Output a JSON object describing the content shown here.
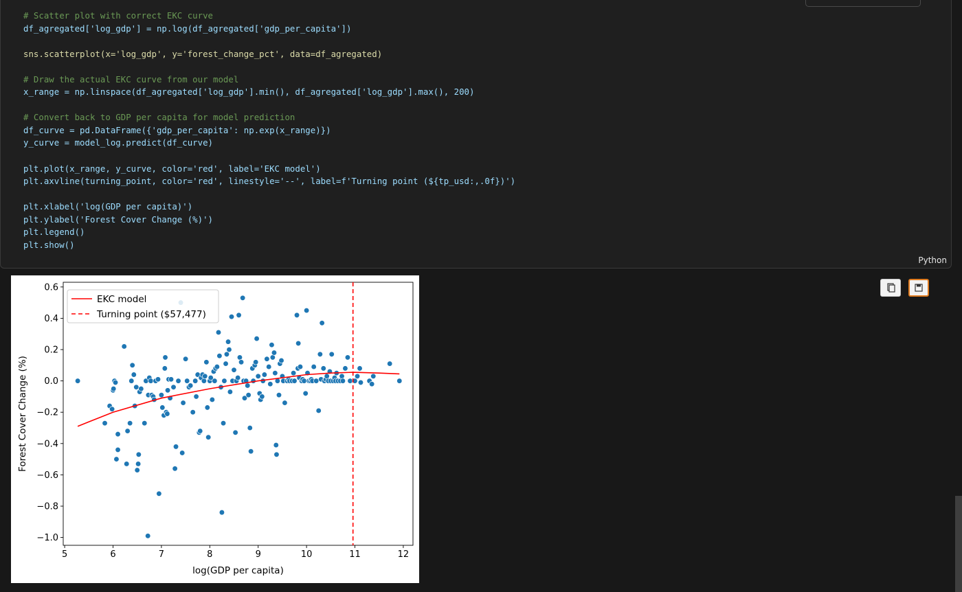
{
  "code_cell": {
    "language": "Python",
    "lines": [
      "# Scatter plot with correct EKC curve",
      "df_agregated['log_gdp'] = np.log(df_agregated['gdp_per_capita'])",
      "",
      "sns.scatterplot(x='log_gdp', y='forest_change_pct', data=df_agregated)",
      "",
      "# Draw the actual EKC curve from our model",
      "x_range = np.linspace(df_agregated['log_gdp'].min(), df_agregated['log_gdp'].max(), 200)",
      "",
      "# Convert back to GDP per capita for model prediction",
      "df_curve = pd.DataFrame({'gdp_per_capita': np.exp(x_range)})",
      "y_curve = model_log.predict(df_curve)",
      "",
      "plt.plot(x_range, y_curve, color='red', label='EKC model')",
      "plt.axvline(turning_point, color='red', linestyle='--', label=f'Turning point (${tp_usd:,.0f})')",
      "",
      "plt.xlabel('log(GDP per capita)')",
      "plt.ylabel('Forest Cover Change (%)')",
      "plt.legend()",
      "plt.show()"
    ]
  },
  "output_toolbar": {
    "copy_icon": "copy-icon",
    "save_icon": "save-icon",
    "accent_color": "#e07b1f"
  },
  "chart_data": {
    "type": "scatter",
    "xlabel": "log(GDP per capita)",
    "ylabel": "Forest Cover Change (%)",
    "xlim": [
      4.97,
      12.2
    ],
    "ylim": [
      -1.05,
      0.63
    ],
    "xticks": [
      5,
      6,
      7,
      8,
      9,
      10,
      11,
      12
    ],
    "yticks": [
      -1.0,
      -0.8,
      -0.6,
      -0.4,
      -0.2,
      0.0,
      0.2,
      0.4,
      0.6
    ],
    "ytick_labels": [
      "−1.0",
      "−0.8",
      "−0.6",
      "−0.4",
      "−0.2",
      "0.0",
      "0.2",
      "0.4",
      "0.6"
    ],
    "grid": false,
    "legend": {
      "placement": "upper-left",
      "entries": [
        "EKC model",
        "Turning point ($57,477)"
      ]
    },
    "colors": {
      "points": "#1f77b4",
      "curve": "#ff0000",
      "turning_line": "#ff0000"
    },
    "turning_point_x": 10.96,
    "curve": {
      "x": [
        5.27,
        6.0,
        7.0,
        8.0,
        9.0,
        10.0,
        10.5,
        10.96,
        11.5,
        11.92
      ],
      "y": [
        -0.29,
        -0.2,
        -0.11,
        -0.05,
        0.0,
        0.04,
        0.05,
        0.055,
        0.05,
        0.045
      ]
    },
    "points": [
      [
        5.27,
        0.0
      ],
      [
        5.83,
        -0.27
      ],
      [
        5.93,
        -0.16
      ],
      [
        5.98,
        -0.18
      ],
      [
        6.0,
        -0.06
      ],
      [
        6.01,
        -0.05
      ],
      [
        6.03,
        0.0
      ],
      [
        6.05,
        -0.01
      ],
      [
        6.07,
        -0.5
      ],
      [
        6.1,
        -0.34
      ],
      [
        6.1,
        -0.44
      ],
      [
        6.23,
        0.22
      ],
      [
        6.28,
        -0.53
      ],
      [
        6.3,
        -0.32
      ],
      [
        6.35,
        -0.27
      ],
      [
        6.38,
        0.0
      ],
      [
        6.4,
        0.1
      ],
      [
        6.43,
        0.04
      ],
      [
        6.45,
        -0.16
      ],
      [
        6.48,
        -0.04
      ],
      [
        6.5,
        -0.57
      ],
      [
        6.52,
        -0.53
      ],
      [
        6.53,
        -0.47
      ],
      [
        6.55,
        -0.07
      ],
      [
        6.58,
        -0.05
      ],
      [
        6.65,
        -0.27
      ],
      [
        6.68,
        0.0
      ],
      [
        6.72,
        -0.99
      ],
      [
        6.73,
        -0.09
      ],
      [
        6.75,
        0.02
      ],
      [
        6.78,
        0.0
      ],
      [
        6.8,
        -0.09
      ],
      [
        6.83,
        -0.1
      ],
      [
        6.85,
        -0.12
      ],
      [
        6.88,
        0.0
      ],
      [
        6.93,
        0.01
      ],
      [
        6.95,
        -0.72
      ],
      [
        7.0,
        -0.09
      ],
      [
        7.02,
        -0.17
      ],
      [
        7.05,
        -0.22
      ],
      [
        7.07,
        0.08
      ],
      [
        7.08,
        0.15
      ],
      [
        7.1,
        -0.2
      ],
      [
        7.12,
        -0.21
      ],
      [
        7.13,
        -0.06
      ],
      [
        7.15,
        0.01
      ],
      [
        7.18,
        -0.11
      ],
      [
        7.2,
        0.01
      ],
      [
        7.25,
        -0.04
      ],
      [
        7.28,
        -0.56
      ],
      [
        7.3,
        -0.42
      ],
      [
        7.35,
        0.0
      ],
      [
        7.4,
        0.5
      ],
      [
        7.43,
        -0.46
      ],
      [
        7.45,
        -0.14
      ],
      [
        7.5,
        0.14
      ],
      [
        7.53,
        0.0
      ],
      [
        7.57,
        -0.04
      ],
      [
        7.6,
        -0.03
      ],
      [
        7.65,
        -0.2
      ],
      [
        7.7,
        0.0
      ],
      [
        7.72,
        -0.1
      ],
      [
        7.75,
        0.04
      ],
      [
        7.78,
        -0.33
      ],
      [
        7.8,
        -0.32
      ],
      [
        7.82,
        0.02
      ],
      [
        7.85,
        0.04
      ],
      [
        7.88,
        0.0
      ],
      [
        7.9,
        0.03
      ],
      [
        7.93,
        0.12
      ],
      [
        7.95,
        -0.17
      ],
      [
        7.97,
        -0.36
      ],
      [
        8.0,
        0.0
      ],
      [
        8.02,
        0.02
      ],
      [
        8.05,
        -0.12
      ],
      [
        8.08,
        0.06
      ],
      [
        8.1,
        0.0
      ],
      [
        8.12,
        0.08
      ],
      [
        8.15,
        0.09
      ],
      [
        8.18,
        0.31
      ],
      [
        8.2,
        0.16
      ],
      [
        8.23,
        -0.04
      ],
      [
        8.25,
        -0.84
      ],
      [
        8.28,
        -0.27
      ],
      [
        8.3,
        0.0
      ],
      [
        8.33,
        0.11
      ],
      [
        8.35,
        0.17
      ],
      [
        8.38,
        0.25
      ],
      [
        8.4,
        0.2
      ],
      [
        8.42,
        -0.07
      ],
      [
        8.45,
        0.41
      ],
      [
        8.47,
        0.0
      ],
      [
        8.5,
        0.07
      ],
      [
        8.53,
        -0.33
      ],
      [
        8.55,
        0.0
      ],
      [
        8.58,
        0.02
      ],
      [
        8.6,
        0.42
      ],
      [
        8.62,
        0.15
      ],
      [
        8.65,
        0.12
      ],
      [
        8.68,
        0.53
      ],
      [
        8.7,
        0.0
      ],
      [
        8.72,
        -0.11
      ],
      [
        8.75,
        0.0
      ],
      [
        8.78,
        -0.03
      ],
      [
        8.8,
        -0.09
      ],
      [
        8.83,
        -0.3
      ],
      [
        8.85,
        -0.45
      ],
      [
        8.88,
        0.08
      ],
      [
        8.9,
        0.0
      ],
      [
        8.93,
        0.1
      ],
      [
        8.95,
        0.12
      ],
      [
        8.97,
        0.27
      ],
      [
        9.0,
        0.03
      ],
      [
        9.03,
        -0.08
      ],
      [
        9.05,
        -0.12
      ],
      [
        9.08,
        -0.1
      ],
      [
        9.1,
        0.0
      ],
      [
        9.13,
        0.04
      ],
      [
        9.18,
        0.14
      ],
      [
        9.22,
        0.09
      ],
      [
        9.25,
        -0.02
      ],
      [
        9.28,
        0.23
      ],
      [
        9.3,
        0.15
      ],
      [
        9.33,
        0.18
      ],
      [
        9.35,
        0.05
      ],
      [
        9.37,
        -0.41
      ],
      [
        9.38,
        -0.47
      ],
      [
        9.4,
        0.0
      ],
      [
        9.43,
        -0.09
      ],
      [
        9.45,
        0.11
      ],
      [
        9.48,
        0.13
      ],
      [
        9.5,
        0.03
      ],
      [
        9.52,
        0.0
      ],
      [
        9.55,
        -0.14
      ],
      [
        9.6,
        0.0
      ],
      [
        9.63,
        0.01
      ],
      [
        9.65,
        0.0
      ],
      [
        9.7,
        0.0
      ],
      [
        9.73,
        0.05
      ],
      [
        9.75,
        0.0
      ],
      [
        9.8,
        0.42
      ],
      [
        9.82,
        0.08
      ],
      [
        9.83,
        0.24
      ],
      [
        9.85,
        0.02
      ],
      [
        9.87,
        0.09
      ],
      [
        9.9,
        0.0
      ],
      [
        9.92,
        0.01
      ],
      [
        9.95,
        0.0
      ],
      [
        9.98,
        -0.08
      ],
      [
        10.0,
        0.45
      ],
      [
        10.02,
        0.05
      ],
      [
        10.05,
        0.0
      ],
      [
        10.08,
        0.0
      ],
      [
        10.1,
        0.01
      ],
      [
        10.12,
        0.0
      ],
      [
        10.15,
        0.09
      ],
      [
        10.2,
        0.0
      ],
      [
        10.25,
        -0.19
      ],
      [
        10.28,
        0.17
      ],
      [
        10.3,
        0.01
      ],
      [
        10.32,
        0.37
      ],
      [
        10.35,
        0.08
      ],
      [
        10.37,
        0.0
      ],
      [
        10.4,
        0.01
      ],
      [
        10.42,
        0.03
      ],
      [
        10.45,
        0.0
      ],
      [
        10.48,
        0.06
      ],
      [
        10.5,
        0.0
      ],
      [
        10.52,
        0.17
      ],
      [
        10.55,
        0.0
      ],
      [
        10.58,
        0.02
      ],
      [
        10.6,
        0.0
      ],
      [
        10.62,
        0.05
      ],
      [
        10.65,
        0.0
      ],
      [
        10.7,
        0.0
      ],
      [
        10.73,
        0.03
      ],
      [
        10.75,
        0.0
      ],
      [
        10.8,
        0.08
      ],
      [
        10.85,
        0.15
      ],
      [
        10.9,
        0.0
      ],
      [
        11.0,
        0.0
      ],
      [
        11.05,
        0.03
      ],
      [
        11.1,
        0.08
      ],
      [
        11.12,
        -0.01
      ],
      [
        11.3,
        0.0
      ],
      [
        11.35,
        -0.02
      ],
      [
        11.38,
        0.03
      ],
      [
        11.72,
        0.11
      ],
      [
        11.92,
        0.0
      ]
    ]
  }
}
